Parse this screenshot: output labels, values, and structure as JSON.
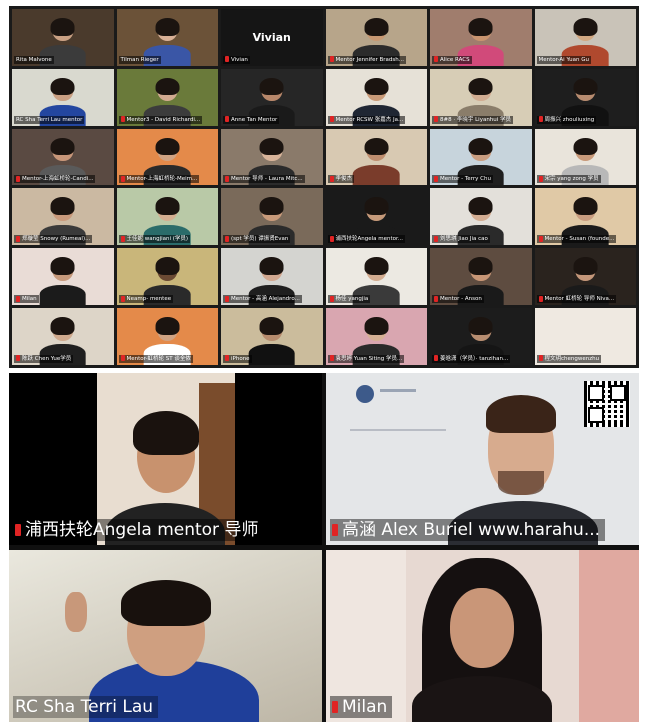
{
  "grid": {
    "tiles": [
      {
        "label": "Rita Malvone",
        "bg": "#4a3a2c",
        "skin": "#c9a083",
        "shirt": "#3b3b3b",
        "muted": false
      },
      {
        "label": "Tilman Rieger",
        "bg": "#6b5238",
        "skin": "#d8b096",
        "shirt": "#3a56a6",
        "muted": false
      },
      {
        "label": "Vivian",
        "center": "Vivian",
        "dark": true,
        "muted": true
      },
      {
        "label": "Mentor Jennifer Bradsh...",
        "bg": "#b7a58a",
        "skin": "#c89872",
        "shirt": "#2b2b2b",
        "muted": true
      },
      {
        "label": "Alice RACS",
        "bg": "#a07d6d",
        "skin": "#c9946f",
        "shirt": "#d14a7a",
        "muted": true
      },
      {
        "label": "Mentor-Ai Yuan Gu",
        "bg": "#c9c3b8",
        "skin": "#d2a882",
        "shirt": "#b0492e",
        "muted": false
      },
      {
        "label": "RC Sha Terri Lau mentor",
        "bg": "#d9d9cf",
        "skin": "#caa083",
        "shirt": "#2346a0",
        "muted": false
      },
      {
        "label": "Mentor3 - David Richardi...",
        "bg": "#6a7a3a",
        "skin": "#d2aa90",
        "shirt": "#3c3c3c",
        "muted": true
      },
      {
        "label": "Anne Tan Mentor",
        "bg": "#262626",
        "skin": "#b8876a",
        "shirt": "#1a1a1a",
        "muted": true
      },
      {
        "label": "Mentor RCSW 张嘉杰 Ja...",
        "bg": "#e6e1d7",
        "skin": "#c99a78",
        "shirt": "#1f2633",
        "muted": true
      },
      {
        "label": "8#8 · 李晓宇 Liyanhui 学员",
        "bg": "#d7cdb6",
        "skin": "#d2ad92",
        "shirt": "#8a7d6a",
        "muted": true
      },
      {
        "label": "周振兴 zhouliuxing",
        "bg": "#1e1e1e",
        "skin": "#b88c70",
        "shirt": "#111111",
        "muted": true
      },
      {
        "label": "Mentor-上海虹桥轮-Candi...",
        "bg": "#5a4a42",
        "skin": "#c79679",
        "shirt": "#5a5a5a",
        "muted": true
      },
      {
        "label": "Mentor-上海虹桥轮-Meim...",
        "bg": "#e48a4a",
        "skin": "#d0a383",
        "shirt": "#2a2a2a",
        "muted": true
      },
      {
        "label": "Mentor 导师 - Laura Mitc...",
        "bg": "#8a7a6a",
        "skin": "#d8b49a",
        "shirt": "#2b2b2b",
        "muted": true
      },
      {
        "label": "李俊杰",
        "bg": "#d8c9b2",
        "skin": "#bf8e6f",
        "shirt": "#7a3c2b",
        "muted": true
      },
      {
        "label": "Mentor - Terry Chu",
        "bg": "#c7d4dc",
        "skin": "#c99d80",
        "shirt": "#1f1f1f",
        "muted": true
      },
      {
        "label": "宋宗 yang zong 学员",
        "bg": "#e9e4db",
        "skin": "#c99a7a",
        "shirt": "#b8b8b8",
        "muted": true
      },
      {
        "label": "郑璇莹 Snowy (Rumeal)...",
        "bg": "#cbb9a2",
        "skin": "#c99a7c",
        "shirt": "#3a3a3a",
        "muted": true
      },
      {
        "label": "王佳妮 wangjiani (学员)",
        "bg": "#b9c9a7",
        "skin": "#d4ae90",
        "shirt": "#2a6c6a",
        "muted": true
      },
      {
        "label": "(spt 学员) 谭振贤Evan",
        "bg": "#7a6a5a",
        "skin": "#c89a7a",
        "shirt": "#2b2b2b",
        "muted": true
      },
      {
        "label": "浦西扶轮Angela mentor...",
        "bg": "#1a1a1a",
        "skin": "#c69a7a",
        "shirt": "#1a1a1a",
        "muted": true
      },
      {
        "label": "刘思琪 Jiao Jia cao",
        "bg": "#e3e0da",
        "skin": "#d3ad92",
        "shirt": "#2a2a2a",
        "muted": true
      },
      {
        "label": "Mentor - Susan (founde...",
        "bg": "#e0c9a6",
        "skin": "#c99d80",
        "shirt": "#1a1a1a",
        "muted": true
      },
      {
        "label": "Milan",
        "bg": "#e9dcd6",
        "skin": "#c79a7c",
        "shirt": "#1b1b1b",
        "muted": true
      },
      {
        "label": "Neamp- mentee",
        "bg": "#c9b67a",
        "skin": "#6b4a33",
        "shirt": "#2a2a2a",
        "muted": true
      },
      {
        "label": "Mentor - 高涵 Alejandro...",
        "bg": "#d4d4d0",
        "skin": "#d2a890",
        "shirt": "#1f1f1f",
        "muted": true
      },
      {
        "label": "杨佳 yangjia",
        "bg": "#ece9e2",
        "skin": "#d3ac90",
        "shirt": "#3a3a3a",
        "muted": true
      },
      {
        "label": "Mentor - Anson",
        "bg": "#5e4c40",
        "skin": "#c89676",
        "shirt": "#1a1a1a",
        "muted": true
      },
      {
        "label": "Mentor 虹桥轮 导师 Niva...",
        "bg": "#2a231e",
        "skin": "#c4977a",
        "shirt": "#1a1a1a",
        "muted": true
      },
      {
        "label": "陈跃 Chen Yue学员",
        "bg": "#ddd5c8",
        "skin": "#d0aa8e",
        "shirt": "#1f1f1f",
        "muted": true
      },
      {
        "label": "Mentor-虹桥轮 ST 谈全侬",
        "bg": "#e48a4a",
        "skin": "#d0a383",
        "shirt": "#ffffff",
        "muted": true
      },
      {
        "label": "iPhone",
        "bg": "#cbbc9c",
        "skin": "#b78c6e",
        "shirt": "#111111",
        "muted": true
      },
      {
        "label": "袁思婷 Yuan Siting 学员...",
        "bg": "#d9a6b0",
        "skin": "#d6b094",
        "shirt": "#2a2a2a",
        "muted": true
      },
      {
        "label": "姜晗潇（学员）· tanzihan...",
        "bg": "#1c1c1c",
        "skin": "#b88d70",
        "shirt": "#151515",
        "muted": true
      },
      {
        "label": "程文玥chengwenzhu",
        "bg": "#efe9e1",
        "skin": "#efe9e1",
        "shirt": "#efe9e1",
        "muted": true
      }
    ]
  },
  "speakers": [
    {
      "name": "浦西扶轮Angela mentor 导师",
      "muted": true
    },
    {
      "name": "高涵 Alex Buriel www.harahu...",
      "muted": true
    },
    {
      "name": "RC Sha  Terri Lau",
      "muted": false
    },
    {
      "name": "Milan",
      "muted": true
    }
  ]
}
